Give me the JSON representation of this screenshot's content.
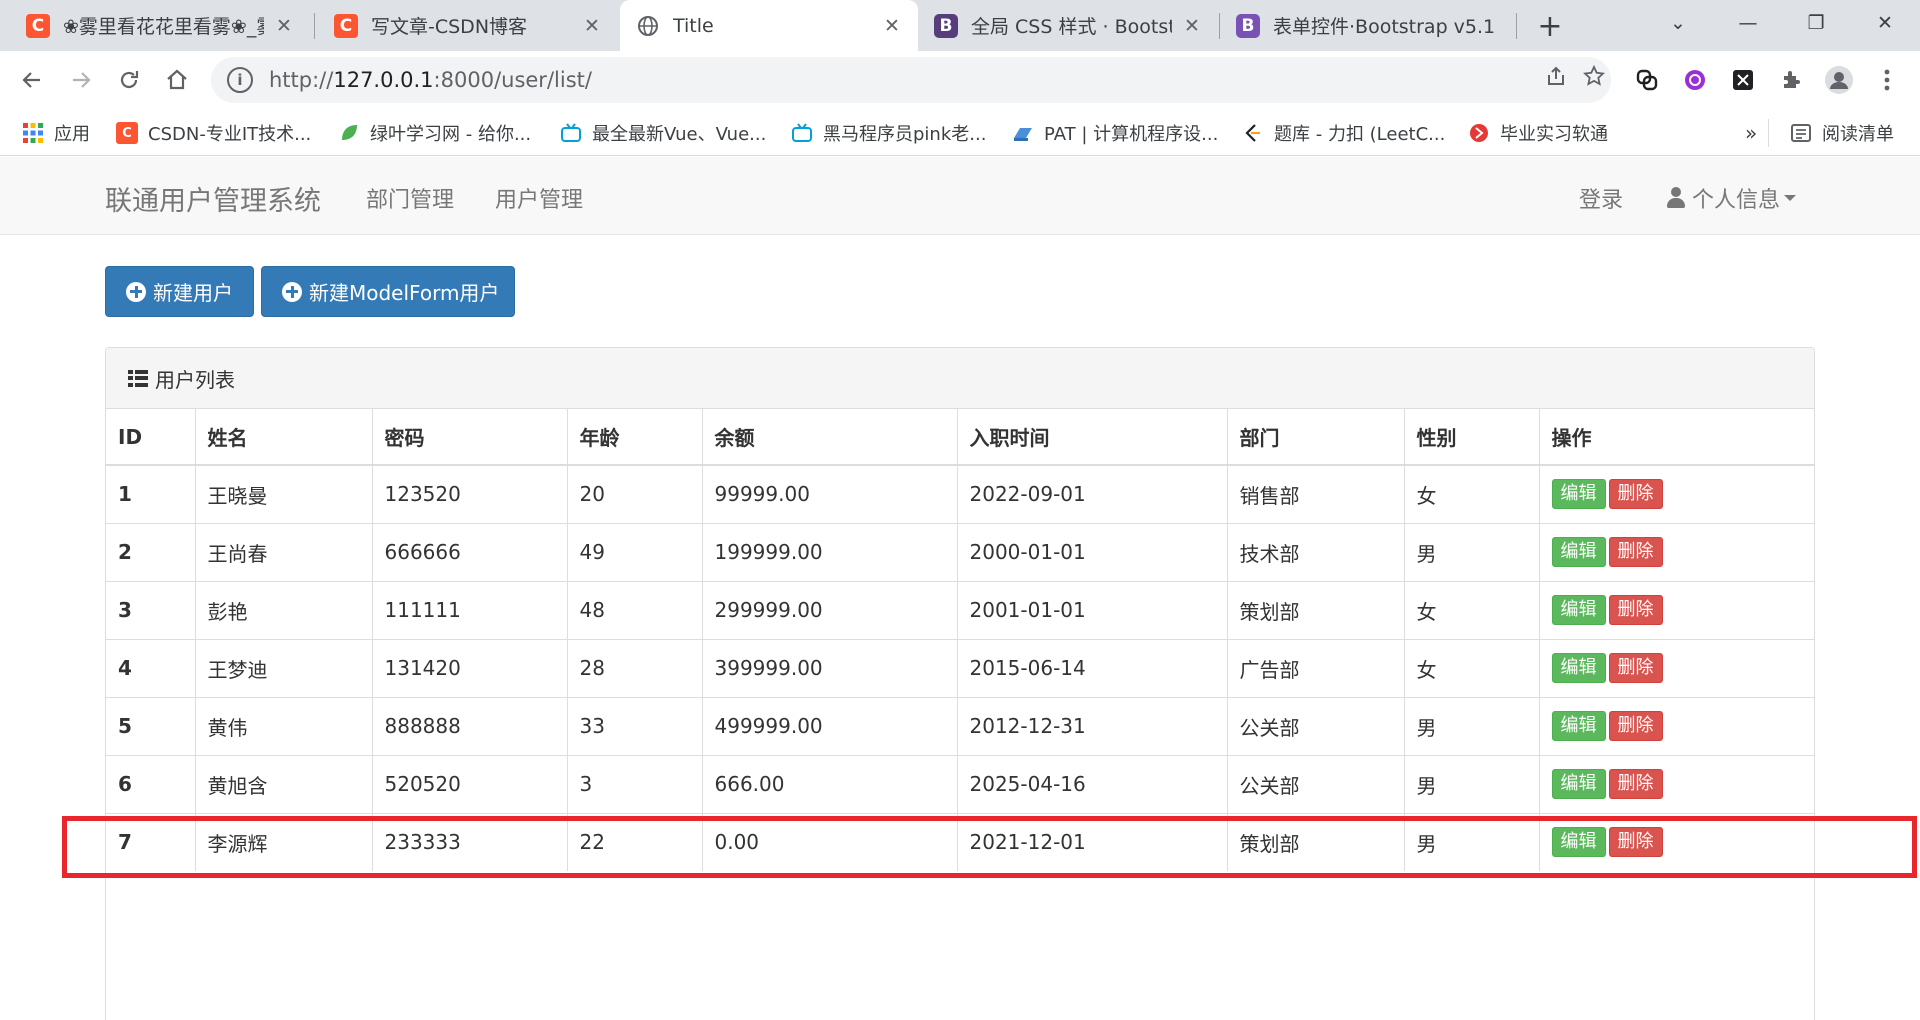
{
  "browser": {
    "tabs": [
      {
        "title": "❀雾里看花花里看雾❀_雾",
        "icon": "csdn-icon",
        "fav": "C",
        "active": false
      },
      {
        "title": "写文章-CSDN博客",
        "icon": "csdn-icon",
        "fav": "C",
        "active": false
      },
      {
        "title": "Title",
        "icon": "globe-icon",
        "fav": "",
        "active": true
      },
      {
        "title": "全局 CSS 样式 · Bootstrap",
        "icon": "bootstrap-icon",
        "fav": "B",
        "active": false
      },
      {
        "title": "表单控件·Bootstrap v5.1",
        "icon": "bootstrap-icon",
        "fav": "B",
        "active": false
      }
    ],
    "tab_close": "✕",
    "new_tab": "+",
    "window_controls": {
      "dropdown": "⌄",
      "minimize": "—",
      "restore": "❐",
      "close": "✕"
    },
    "address": {
      "scheme": "http://",
      "host": "127.0.0.1",
      "rest": ":8000/user/list/"
    },
    "bookmarks": [
      {
        "label": "应用",
        "icon": "apps-grid-icon"
      },
      {
        "label": "CSDN-专业IT技术...",
        "icon": "csdn-icon"
      },
      {
        "label": "绿叶学习网 - 给你...",
        "icon": "leaf-icon"
      },
      {
        "label": "最全最新Vue、Vue...",
        "icon": "bilibili-icon"
      },
      {
        "label": "黑马程序员pink老...",
        "icon": "bilibili-icon"
      },
      {
        "label": "PAT | 计算机程序设...",
        "icon": "pat-icon"
      },
      {
        "label": "题库 - 力扣 (LeetC...",
        "icon": "leetcode-icon"
      },
      {
        "label": "毕业实习软通",
        "icon": "isoftstone-icon"
      }
    ],
    "bookmarks_more": "»",
    "reading_list": "阅读清单"
  },
  "navbar": {
    "brand": "联通用户管理系统",
    "links": [
      "部门管理",
      "用户管理"
    ],
    "login": "登录",
    "profile": "个人信息"
  },
  "actions": {
    "new_user": "新建用户",
    "new_modelform_user": "新建ModelForm用户"
  },
  "panel": {
    "title": "用户列表",
    "columns": [
      "ID",
      "姓名",
      "密码",
      "年龄",
      "余额",
      "入职时间",
      "部门",
      "性别",
      "操作"
    ],
    "edit_label": "编辑",
    "delete_label": "删除",
    "rows": [
      [
        "1",
        "王晓曼",
        "123520",
        "20",
        "99999.00",
        "2022-09-01",
        "销售部",
        "女"
      ],
      [
        "2",
        "王尚春",
        "666666",
        "49",
        "199999.00",
        "2000-01-01",
        "技术部",
        "男"
      ],
      [
        "3",
        "彭艳",
        "111111",
        "48",
        "299999.00",
        "2001-01-01",
        "策划部",
        "女"
      ],
      [
        "4",
        "王梦迪",
        "131420",
        "28",
        "399999.00",
        "2015-06-14",
        "广告部",
        "女"
      ],
      [
        "5",
        "黄伟",
        "888888",
        "33",
        "499999.00",
        "2012-12-31",
        "公关部",
        "男"
      ],
      [
        "6",
        "黄旭含",
        "520520",
        "3",
        "666.00",
        "2025-04-16",
        "公关部",
        "男"
      ],
      [
        "7",
        "李源辉",
        "233333",
        "22",
        "0.00",
        "2021-12-01",
        "策划部",
        "男"
      ]
    ]
  },
  "colors": {
    "primary": "#337ab7",
    "success": "#5cb85c",
    "danger": "#d9534f",
    "highlight": "#e8262c"
  }
}
